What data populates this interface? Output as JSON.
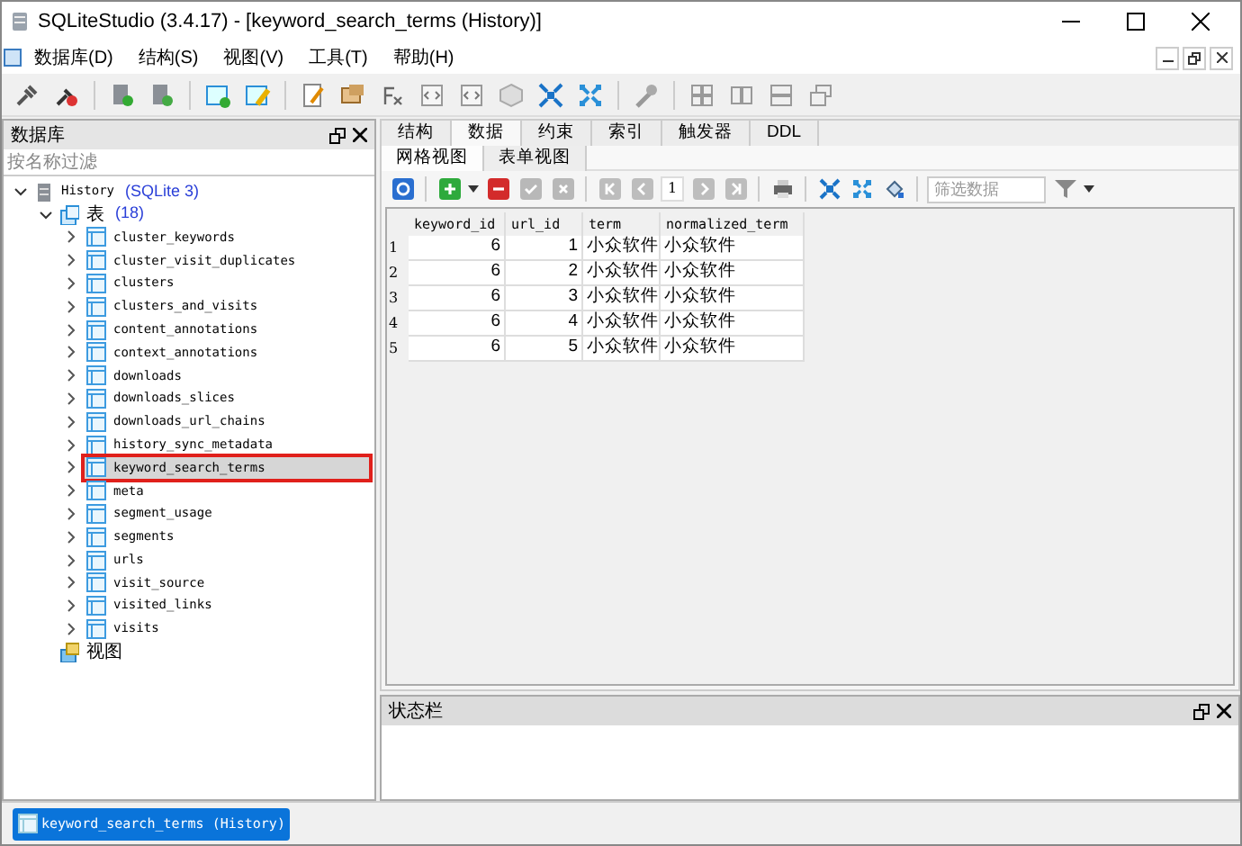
{
  "window": {
    "title": "SQLiteStudio (3.4.17) - [keyword_search_terms (History)]"
  },
  "menu": [
    "数据库(D)",
    "结构(S)",
    "视图(V)",
    "工具(T)",
    "帮助(H)"
  ],
  "main_toolbar": [
    {
      "kind": "plug"
    },
    {
      "kind": "unplug"
    },
    {
      "kind": "db-add"
    },
    {
      "kind": "db-refresh"
    },
    {
      "kind": "table-add"
    },
    {
      "kind": "table-edit"
    },
    {
      "kind": "sql-edit"
    },
    {
      "kind": "import"
    },
    {
      "kind": "function"
    },
    {
      "kind": "code"
    },
    {
      "kind": "code"
    },
    {
      "kind": "cube"
    },
    {
      "kind": "collapse"
    },
    {
      "kind": "expand"
    },
    {
      "kind": "wrench"
    },
    {
      "kind": "tile"
    },
    {
      "kind": "tile-v"
    },
    {
      "kind": "tile-h"
    },
    {
      "kind": "cascade"
    }
  ],
  "database_panel": {
    "title": "数据库",
    "filter_placeholder": "按名称过滤",
    "tree": [
      {
        "kind": "database",
        "label": "History",
        "detail": "(SQLite 3)",
        "expanded": true,
        "children": [
          {
            "kind": "folder",
            "label": "表",
            "detail": "(18)",
            "expanded": true,
            "children": [
              {
                "kind": "table",
                "label": "cluster_keywords",
                "selected": false,
                "annotated": false
              },
              {
                "kind": "table",
                "label": "cluster_visit_duplicates",
                "selected": false,
                "annotated": false
              },
              {
                "kind": "table",
                "label": "clusters",
                "selected": false,
                "annotated": false
              },
              {
                "kind": "table",
                "label": "clusters_and_visits",
                "selected": false,
                "annotated": false
              },
              {
                "kind": "table",
                "label": "content_annotations",
                "selected": false,
                "annotated": false
              },
              {
                "kind": "table",
                "label": "context_annotations",
                "selected": false,
                "annotated": false
              },
              {
                "kind": "table",
                "label": "downloads",
                "selected": false,
                "annotated": false
              },
              {
                "kind": "table",
                "label": "downloads_slices",
                "selected": false,
                "annotated": false
              },
              {
                "kind": "table",
                "label": "downloads_url_chains",
                "selected": false,
                "annotated": false
              },
              {
                "kind": "table",
                "label": "history_sync_metadata",
                "selected": false,
                "annotated": false
              },
              {
                "kind": "table",
                "label": "keyword_search_terms",
                "selected": true,
                "annotated": true
              },
              {
                "kind": "table",
                "label": "meta",
                "selected": false,
                "annotated": false
              },
              {
                "kind": "table",
                "label": "segment_usage",
                "selected": false,
                "annotated": false
              },
              {
                "kind": "table",
                "label": "segments",
                "selected": false,
                "annotated": false
              },
              {
                "kind": "table",
                "label": "urls",
                "selected": false,
                "annotated": false
              },
              {
                "kind": "table",
                "label": "visit_source",
                "selected": false,
                "annotated": false
              },
              {
                "kind": "table",
                "label": "visited_links",
                "selected": false,
                "annotated": false
              },
              {
                "kind": "table",
                "label": "visits",
                "selected": false,
                "annotated": false
              }
            ]
          },
          {
            "kind": "views",
            "label": "视图"
          }
        ]
      }
    ]
  },
  "tabs": [
    {
      "label": "结构",
      "selected": false
    },
    {
      "label": "数据",
      "selected": true
    },
    {
      "label": "约束",
      "selected": false
    },
    {
      "label": "索引",
      "selected": false
    },
    {
      "label": "触发器",
      "selected": false
    },
    {
      "label": "DDL",
      "selected": false
    }
  ],
  "subtabs": [
    {
      "label": "网格视图",
      "selected": true
    },
    {
      "label": "表单视图",
      "selected": false
    }
  ],
  "data_toolbar": {
    "page": "1",
    "filter_placeholder": "筛选数据"
  },
  "table": {
    "columns": [
      "keyword_id",
      "url_id",
      "term",
      "normalized_term"
    ],
    "rows": [
      {
        "number": "1",
        "cells": [
          "6",
          "1",
          "小众软件",
          "小众软件"
        ]
      },
      {
        "number": "2",
        "cells": [
          "6",
          "2",
          "小众软件",
          "小众软件"
        ]
      },
      {
        "number": "3",
        "cells": [
          "6",
          "3",
          "小众软件",
          "小众软件"
        ]
      },
      {
        "number": "4",
        "cells": [
          "6",
          "4",
          "小众软件",
          "小众软件"
        ]
      },
      {
        "number": "5",
        "cells": [
          "6",
          "5",
          "小众软件",
          "小众软件"
        ]
      }
    ]
  },
  "status_panel": {
    "title": "状态栏"
  },
  "taskbar": [
    {
      "label": "keyword_search_terms (History)",
      "selected": true
    }
  ]
}
